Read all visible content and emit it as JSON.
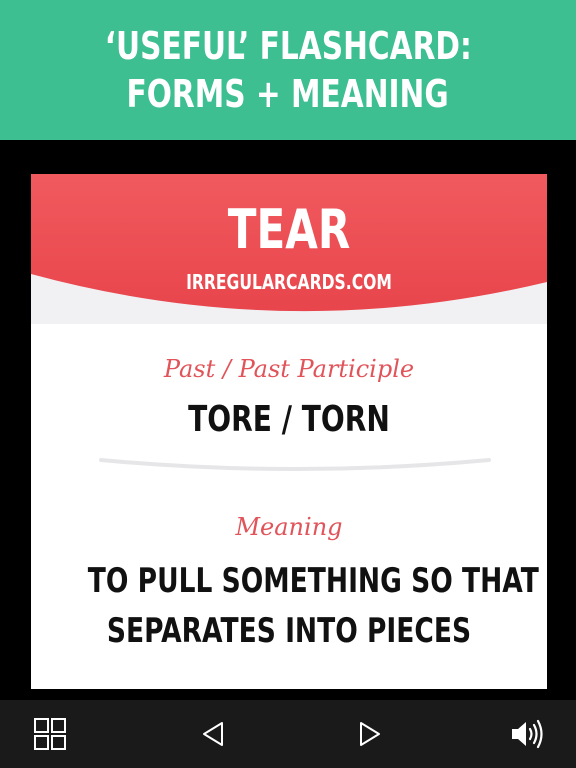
{
  "header": {
    "title_line1": "‘USEFUL’ FLASHCARD:",
    "title_line2": "FORMS + MEANING",
    "background": "#3dbf92"
  },
  "card": {
    "word": "TEAR",
    "site": "IRREGULARCARDS.COM",
    "forms_label": "Past / Past Participle",
    "forms_value": "TORE / TORN",
    "meaning_label": "Meaning",
    "meaning_line1": "TO PULL SOMETHING SO THAT IT",
    "meaning_line2": "SEPARATES INTO PIECES",
    "accent_color": "#e8494f",
    "label_color": "#e0545a"
  },
  "toolbar": {
    "grid_icon": "grid-icon",
    "prev_icon": "triangle-left-icon",
    "next_icon": "triangle-right-icon",
    "sound_icon": "speaker-icon"
  }
}
